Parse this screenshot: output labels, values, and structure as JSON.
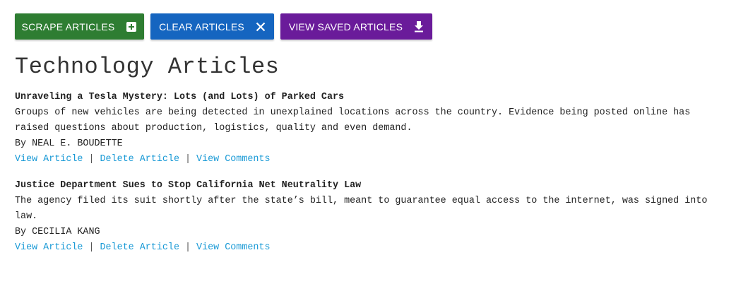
{
  "toolbar": {
    "scrape_label": "SCRAPE ARTICLES",
    "scrape_icon": "plus-box-icon",
    "clear_label": "CLEAR ARTICLES",
    "clear_icon": "close-icon",
    "saved_label": "VIEW SAVED ARTICLES",
    "saved_icon": "download-icon",
    "colors": {
      "scrape": "#2e7d32",
      "clear": "#1565c0",
      "saved": "#6a1b9a"
    }
  },
  "page": {
    "title": "Technology Articles"
  },
  "articles": [
    {
      "title": "Unraveling a Tesla Mystery: Lots (and Lots) of Parked Cars",
      "summary": "Groups of new vehicles are being detected in unexplained locations across the country. Evidence being posted online has raised questions about production, logistics, quality and even demand.",
      "byline": "By NEAL E. BOUDETTE",
      "view_label": "View Article",
      "delete_label": "Delete Article",
      "comments_label": "View Comments",
      "separator": "|"
    },
    {
      "title": "Justice Department Sues to Stop California Net Neutrality Law",
      "summary": "The agency filed its suit shortly after the state’s bill, meant to guarantee equal access to the internet, was signed into law.",
      "byline": "By CECILIA KANG",
      "view_label": "View Article",
      "delete_label": "Delete Article",
      "comments_label": "View Comments",
      "separator": "|"
    }
  ],
  "link_color": "#1a9ad6"
}
